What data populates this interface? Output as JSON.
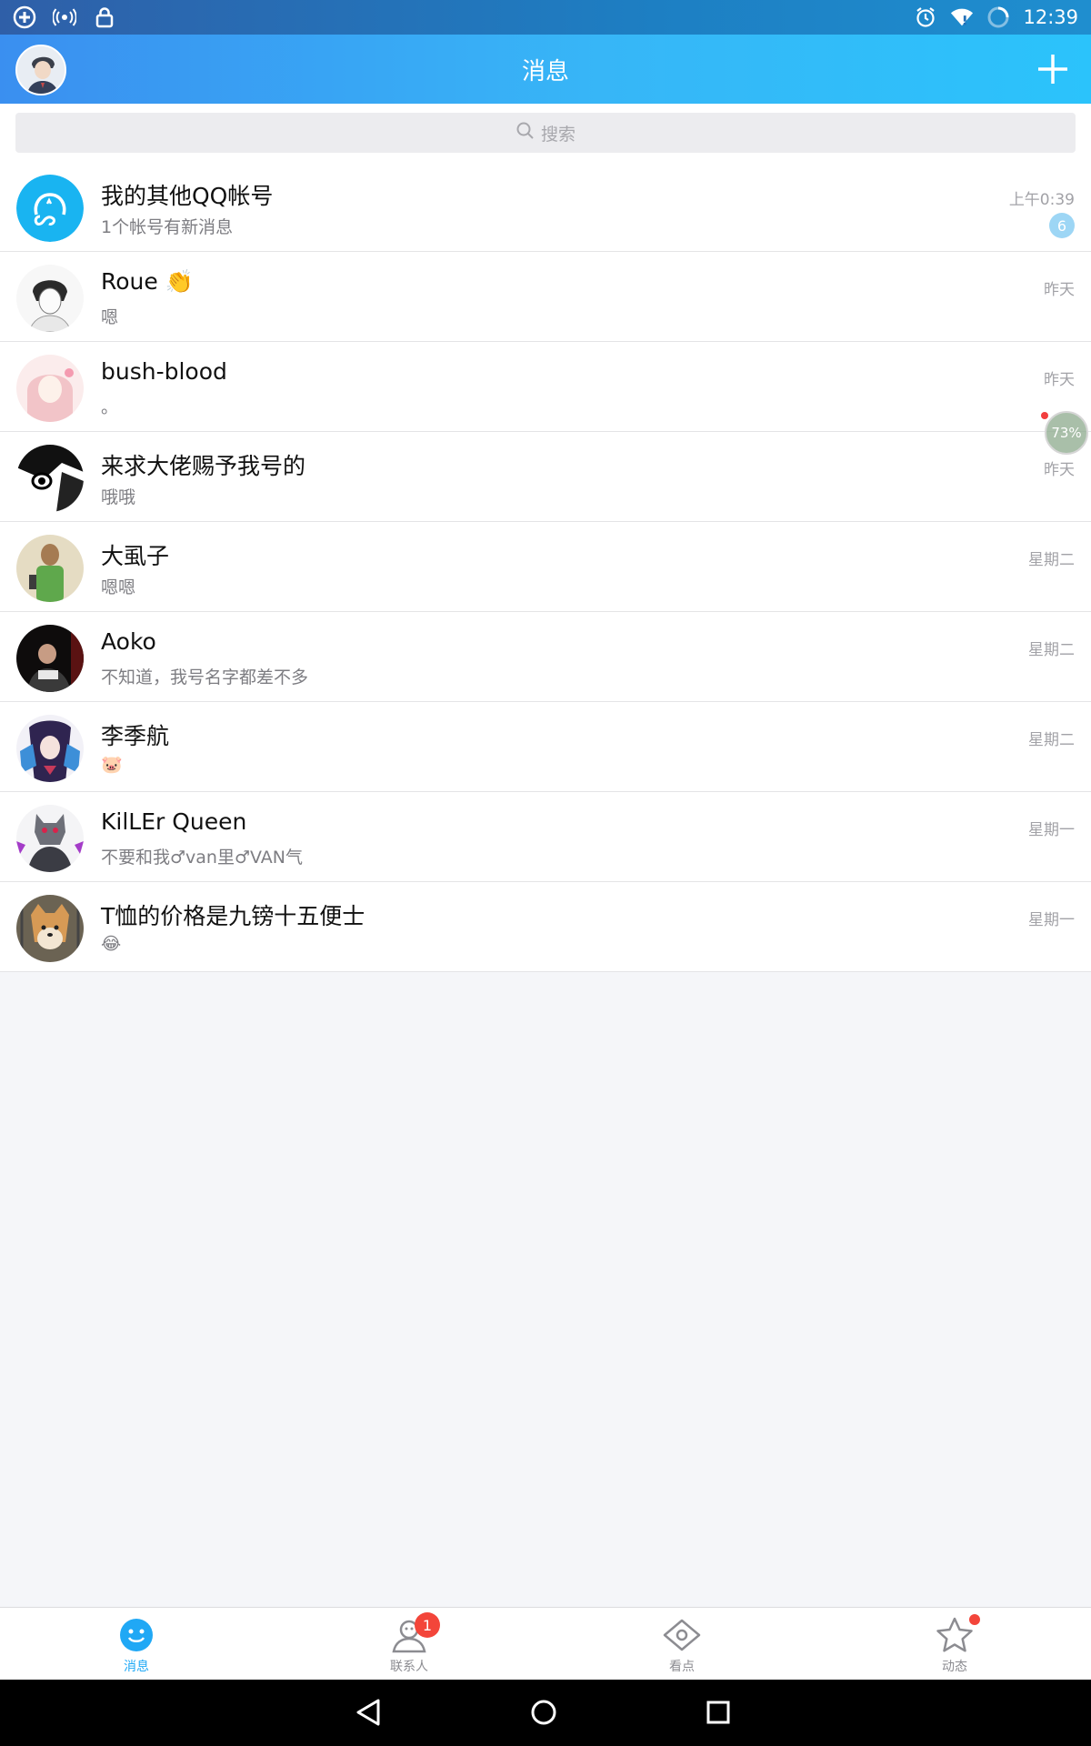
{
  "status_bar": {
    "time": "12:39",
    "left_icons": [
      "plus-circle-icon",
      "wifi-signal-icon",
      "lock-icon"
    ],
    "right_icons": [
      "alarm-icon",
      "wifi-icon",
      "sync-icon"
    ]
  },
  "header": {
    "title": "消息",
    "add_icon": "plus-icon"
  },
  "search": {
    "placeholder": "搜索"
  },
  "conversations": [
    {
      "name": "我的其他QQ帐号",
      "message": "1个帐号有新消息",
      "time": "上午0:39",
      "badge": "6"
    },
    {
      "name": "Roue",
      "name_emoji": "👏",
      "message": "嗯",
      "time": "昨天"
    },
    {
      "name": "bush-blood",
      "message": "。",
      "time": "昨天"
    },
    {
      "name": "来求大佬赐予我号的",
      "message": "哦哦",
      "time": "昨天"
    },
    {
      "name": "大虱子",
      "message": "嗯嗯",
      "time": "星期二"
    },
    {
      "name": "Aoko",
      "message": "不知道，我号名字都差不多",
      "time": "星期二"
    },
    {
      "name": "李季航",
      "message": "🐷",
      "time": "星期二"
    },
    {
      "name": "KilLEr  Queen",
      "message": "不要和我♂van里♂VAN气",
      "time": "星期一"
    },
    {
      "name": "T恤的价格是九镑十五便士",
      "message": "😂",
      "time": "星期一"
    }
  ],
  "floating_widget": {
    "percent": "73%"
  },
  "tabs": [
    {
      "label": "消息",
      "icon": "message-smile-icon",
      "active": true
    },
    {
      "label": "联系人",
      "icon": "contacts-icon",
      "badge": "1"
    },
    {
      "label": "看点",
      "icon": "eye-icon"
    },
    {
      "label": "动态",
      "icon": "star-icon",
      "dot": true
    }
  ],
  "colors": {
    "accent": "#20a8f5",
    "header_start": "#3a8ff0",
    "header_end": "#2bc3fb",
    "badge_red": "#f3453a"
  }
}
